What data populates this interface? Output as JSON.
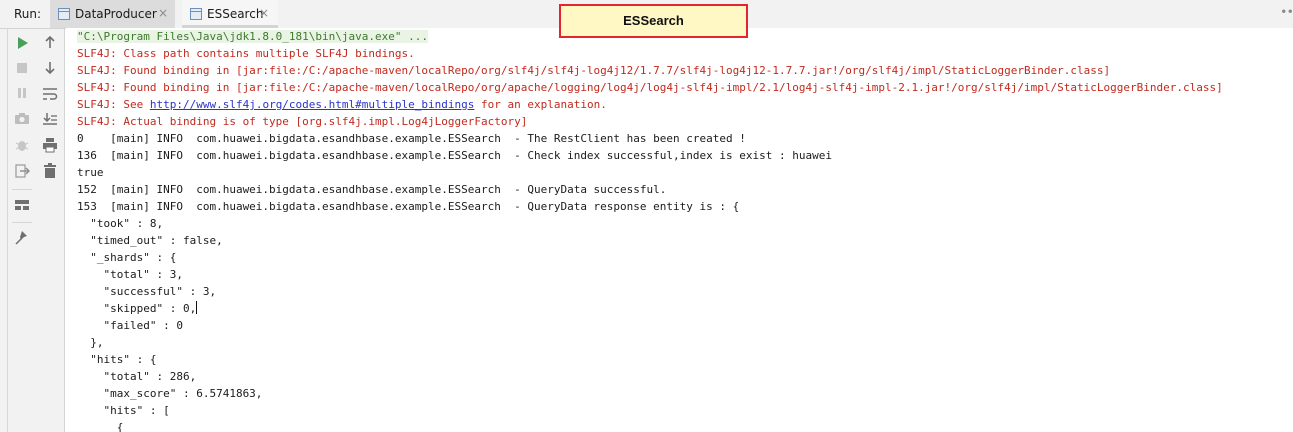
{
  "run_panel": {
    "label": "Run:",
    "tabs": [
      {
        "label": "DataProducer",
        "close": "×"
      },
      {
        "label": "ESSearch",
        "close": "×"
      }
    ],
    "overflow": "∙∙∙"
  },
  "floating_title": "ESSearch",
  "toolbar_icons": [
    "run-icon",
    "stop-icon",
    "pause-icon",
    "camera-icon",
    "debug-bug-icon",
    "exit-icon",
    "layout-icon",
    "pin-icon",
    "up-arrow-icon",
    "down-arrow-icon",
    "soft-wrap-icon",
    "scroll-to-end-icon",
    "print-icon",
    "trash-icon"
  ],
  "console": {
    "command": "\"C:\\Program Files\\Java\\jdk1.8.0_181\\bin\\java.exe\" ...",
    "slf4j_1": "SLF4J: Class path contains multiple SLF4J bindings.",
    "slf4j_2": "SLF4J: Found binding in [jar:file:/C:/apache-maven/localRepo/org/slf4j/slf4j-log4j12/1.7.7/slf4j-log4j12-1.7.7.jar!/org/slf4j/impl/StaticLoggerBinder.class]",
    "slf4j_3": "SLF4J: Found binding in [jar:file:/C:/apache-maven/localRepo/org/apache/logging/log4j/log4j-slf4j-impl/2.1/log4j-slf4j-impl-2.1.jar!/org/slf4j/impl/StaticLoggerBinder.class]",
    "slf4j_see_prefix": "SLF4J: See ",
    "slf4j_link": "http://www.slf4j.org/codes.html#multiple_bindings",
    "slf4j_see_suffix": " for an explanation.",
    "slf4j_5": "SLF4J: Actual binding is of type [org.slf4j.impl.Log4jLoggerFactory]",
    "log_1": "0    [main] INFO  com.huawei.bigdata.esandhbase.example.ESSearch  - The RestClient has been created !",
    "log_2": "136  [main] INFO  com.huawei.bigdata.esandhbase.example.ESSearch  - Check index successful,index is exist : huawei",
    "log_3": "true",
    "log_4": "152  [main] INFO  com.huawei.bigdata.esandhbase.example.ESSearch  - QueryData successful.",
    "log_5": "153  [main] INFO  com.huawei.bigdata.esandhbase.example.ESSearch  - QueryData response entity is : {",
    "j1": "  \"took\" : 8,",
    "j2": "  \"timed_out\" : false,",
    "j3": "  \"_shards\" : {",
    "j4": "    \"total\" : 3,",
    "j5": "    \"successful\" : 3,",
    "j6": "    \"skipped\" : 0,",
    "j7": "    \"failed\" : 0",
    "j8": "  },",
    "j9": "  \"hits\" : {",
    "j10": "    \"total\" : 286,",
    "j11": "    \"max_score\" : 6.5741863,",
    "j12": "    \"hits\" : [",
    "j13": "      {"
  }
}
